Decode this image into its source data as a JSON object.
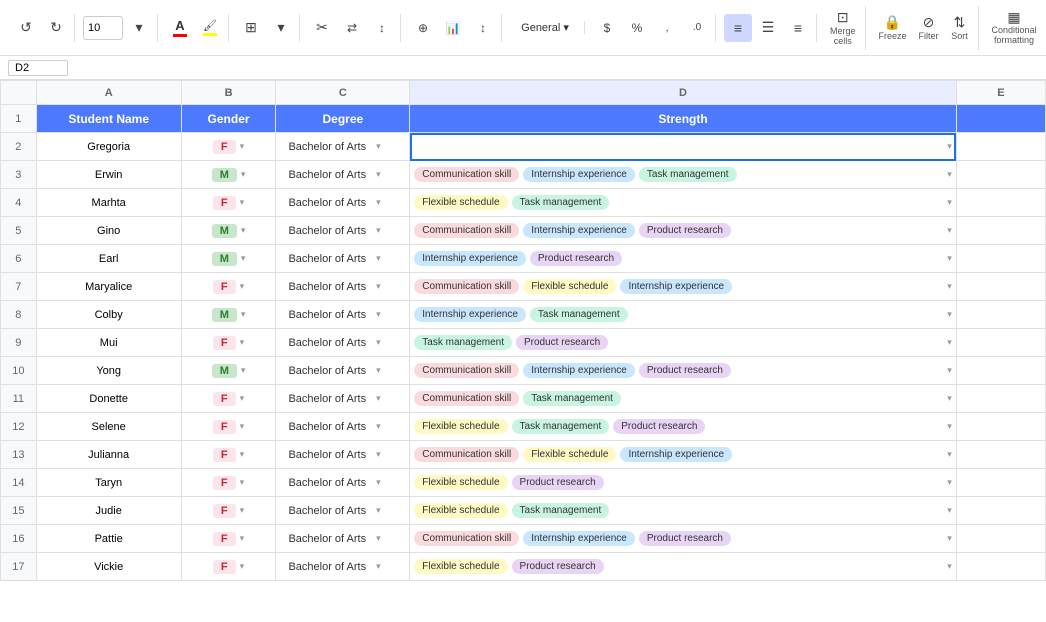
{
  "toolbar": {
    "undo_label": "Undo",
    "redo_label": "Redo",
    "font_size": "10",
    "merge_cells_label": "Merge cells",
    "freeze_label": "Freeze",
    "filter_label": "Filter",
    "sort_label": "Sort",
    "conditional_formatting_label": "Conditional formatting",
    "smart_transfer_label": "Smart transfer"
  },
  "cell_ref": "D2",
  "columns": {
    "row_col": "",
    "a_header": "",
    "b_header": "B",
    "c_header": "C",
    "d_header": "D",
    "e_header": "E"
  },
  "header_row": {
    "row_num": "1",
    "student_name": "Student Name",
    "gender": "Gender",
    "degree": "Degree",
    "strength": "Strength"
  },
  "rows": [
    {
      "num": "2",
      "name": "Gregoria",
      "gender": "F",
      "degree": "Bachelor of Arts",
      "tags": []
    },
    {
      "num": "3",
      "name": "Erwin",
      "gender": "M",
      "degree": "Bachelor of Arts",
      "tags": [
        {
          "label": "Communication skill",
          "color": "tag-pink"
        },
        {
          "label": "Internship experience",
          "color": "tag-blue"
        },
        {
          "label": "Task management",
          "color": "tag-green"
        }
      ]
    },
    {
      "num": "4",
      "name": "Marhta",
      "gender": "F",
      "degree": "Bachelor of Arts",
      "tags": [
        {
          "label": "Flexible schedule",
          "color": "tag-yellow"
        },
        {
          "label": "Task management",
          "color": "tag-green"
        }
      ]
    },
    {
      "num": "5",
      "name": "Gino",
      "gender": "M",
      "degree": "Bachelor of Arts",
      "tags": [
        {
          "label": "Communication skill",
          "color": "tag-pink"
        },
        {
          "label": "Internship experience",
          "color": "tag-blue"
        },
        {
          "label": "Product research",
          "color": "tag-purple"
        }
      ]
    },
    {
      "num": "6",
      "name": "Earl",
      "gender": "M",
      "degree": "Bachelor of Arts",
      "tags": [
        {
          "label": "Internship experience",
          "color": "tag-blue"
        },
        {
          "label": "Product research",
          "color": "tag-purple"
        }
      ]
    },
    {
      "num": "7",
      "name": "Maryalice",
      "gender": "F",
      "degree": "Bachelor of Arts",
      "tags": [
        {
          "label": "Communication skill",
          "color": "tag-pink"
        },
        {
          "label": "Flexible schedule",
          "color": "tag-yellow"
        },
        {
          "label": "Internship experience",
          "color": "tag-blue"
        }
      ]
    },
    {
      "num": "8",
      "name": "Colby",
      "gender": "M",
      "degree": "Bachelor of Arts",
      "tags": [
        {
          "label": "Internship experience",
          "color": "tag-blue"
        },
        {
          "label": "Task management",
          "color": "tag-green"
        }
      ]
    },
    {
      "num": "9",
      "name": "Mui",
      "gender": "F",
      "degree": "Bachelor of Arts",
      "tags": [
        {
          "label": "Task management",
          "color": "tag-green"
        },
        {
          "label": "Product research",
          "color": "tag-purple"
        }
      ]
    },
    {
      "num": "10",
      "name": "Yong",
      "gender": "M",
      "degree": "Bachelor of Arts",
      "tags": [
        {
          "label": "Communication skill",
          "color": "tag-pink"
        },
        {
          "label": "Internship experience",
          "color": "tag-blue"
        },
        {
          "label": "Product research",
          "color": "tag-purple"
        }
      ]
    },
    {
      "num": "11",
      "name": "Donette",
      "gender": "F",
      "degree": "Bachelor of Arts",
      "tags": [
        {
          "label": "Communication skill",
          "color": "tag-pink"
        },
        {
          "label": "Task management",
          "color": "tag-green"
        }
      ]
    },
    {
      "num": "12",
      "name": "Selene",
      "gender": "F",
      "degree": "Bachelor of Arts",
      "tags": [
        {
          "label": "Flexible schedule",
          "color": "tag-yellow"
        },
        {
          "label": "Task management",
          "color": "tag-green"
        },
        {
          "label": "Product research",
          "color": "tag-purple"
        }
      ]
    },
    {
      "num": "13",
      "name": "Julianna",
      "gender": "F",
      "degree": "Bachelor of Arts",
      "tags": [
        {
          "label": "Communication skill",
          "color": "tag-pink"
        },
        {
          "label": "Flexible schedule",
          "color": "tag-yellow"
        },
        {
          "label": "Internship experience",
          "color": "tag-blue"
        }
      ]
    },
    {
      "num": "14",
      "name": "Taryn",
      "gender": "F",
      "degree": "Bachelor of Arts",
      "tags": [
        {
          "label": "Flexible schedule",
          "color": "tag-yellow"
        },
        {
          "label": "Product research",
          "color": "tag-purple"
        }
      ]
    },
    {
      "num": "15",
      "name": "Judie",
      "gender": "F",
      "degree": "Bachelor of Arts",
      "tags": [
        {
          "label": "Flexible schedule",
          "color": "tag-yellow"
        },
        {
          "label": "Task management",
          "color": "tag-green"
        }
      ]
    },
    {
      "num": "16",
      "name": "Pattie",
      "gender": "F",
      "degree": "Bachelor of Arts",
      "tags": [
        {
          "label": "Communication skill",
          "color": "tag-pink"
        },
        {
          "label": "Internship experience",
          "color": "tag-blue"
        },
        {
          "label": "Product research",
          "color": "tag-purple"
        }
      ]
    },
    {
      "num": "17",
      "name": "Vickie",
      "gender": "F",
      "degree": "Bachelor of Arts",
      "tags": [
        {
          "label": "Flexible schedule",
          "color": "tag-yellow"
        },
        {
          "label": "Product research",
          "color": "tag-purple"
        }
      ]
    }
  ]
}
